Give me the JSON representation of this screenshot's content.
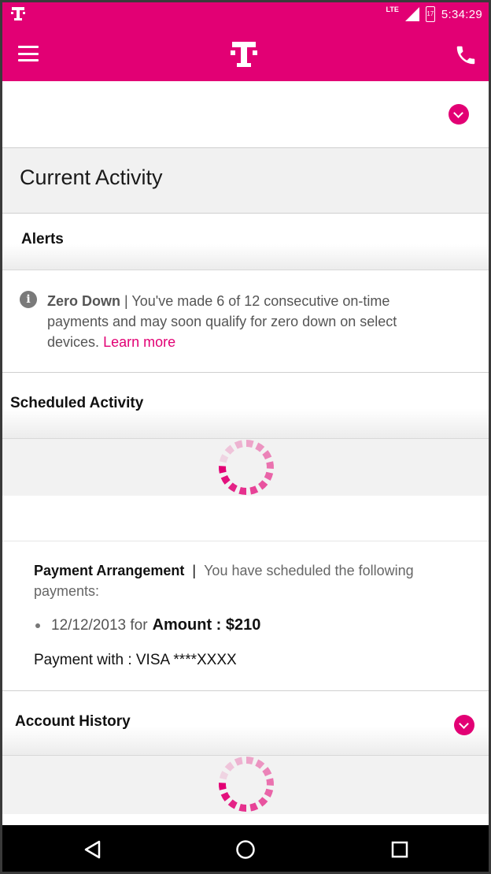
{
  "status_bar": {
    "network": "LTE",
    "battery": "17",
    "time": "5:34:29"
  },
  "icons": {
    "status_logo": "t-mobile-logo-icon",
    "signal": "signal-icon",
    "battery": "battery-icon",
    "menu": "hamburger-menu-icon",
    "brand": "t-mobile-logo-icon",
    "call": "phone-icon",
    "expand": "chevron-down-icon",
    "info": "info-icon",
    "loading": "spinner-icon",
    "back": "back-icon",
    "home": "home-icon",
    "recents": "recents-icon"
  },
  "colors": {
    "brand": "#e20074",
    "section_bg": "#f1f1f1"
  },
  "current_activity": {
    "title": "Current Activity"
  },
  "alerts": {
    "heading": "Alerts",
    "items": [
      {
        "title": "Zero Down",
        "separator": "|",
        "message": "You've made 6 of 12 consecutive on-time payments and may soon qualify for zero down on select devices.",
        "link": "Learn more"
      }
    ]
  },
  "scheduled_activity": {
    "heading": "Scheduled Activity",
    "payment_arrangement": {
      "title": "Payment Arrangement",
      "separator": "|",
      "description": "You have scheduled the following payments:",
      "payments": [
        {
          "date": "12/12/2013",
          "connector": "for",
          "amount_label": "Amount : $210"
        }
      ],
      "method": "Payment with : VISA ****XXXX"
    }
  },
  "account_history": {
    "heading": "Account History"
  }
}
